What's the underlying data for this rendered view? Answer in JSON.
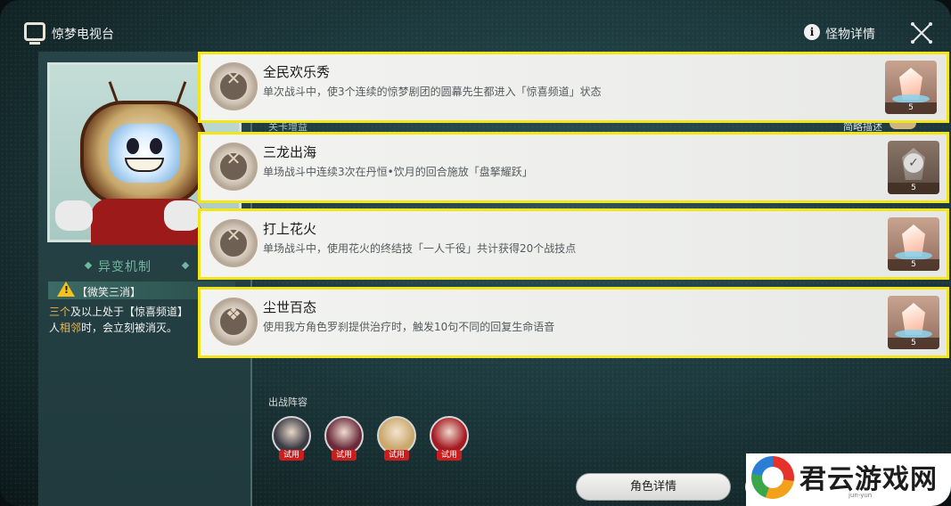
{
  "window": {
    "title": "惊梦电视台",
    "close_icon": "close-x-icon"
  },
  "header": {
    "info_label": "怪物详情",
    "info_icon": "info-icon"
  },
  "left": {
    "mechanic_title": "异变机制",
    "mechanic_name": "【微笑三消】",
    "mechanic_desc_parts": [
      "三个",
      "及以上处于【惊喜频道】",
      "人",
      "相邻",
      "时，会立刻被消灭。"
    ]
  },
  "main": {
    "sub_label": "关卡增益",
    "toggle_label": "简略描述",
    "challenges": [
      {
        "title": "全民欢乐秀",
        "desc": "单次战斗中，使3个连续的惊梦剧团的圆幕先生都进入「惊喜频道」状态",
        "reward_count": "5",
        "completed": false
      },
      {
        "title": "三龙出海",
        "desc": "单场战斗中连续3次在丹恒•饮月的回合施放「盘拏耀跃」",
        "reward_count": "5",
        "completed": true
      },
      {
        "title": "打上花火",
        "desc": "单场战斗中，使用花火的终结技「一人千役」共计获得20个战技点",
        "reward_count": "5",
        "completed": false
      },
      {
        "title": "尘世百态",
        "desc": "使用我方角色罗刹提供治疗时，触发10句不同的回复生命语音",
        "reward_count": "5",
        "completed": false
      }
    ],
    "team_label": "出战阵容",
    "team": [
      {
        "badge": "试用",
        "color": "#3a3a44"
      },
      {
        "badge": "试用",
        "color": "#6a2a3a"
      },
      {
        "badge": "试用",
        "color": "#c9a86a"
      },
      {
        "badge": "试用",
        "color": "#a51a22"
      }
    ],
    "role_button": "角色详情"
  },
  "watermark": {
    "text": "君云游戏网",
    "sub": "jun-yun"
  }
}
